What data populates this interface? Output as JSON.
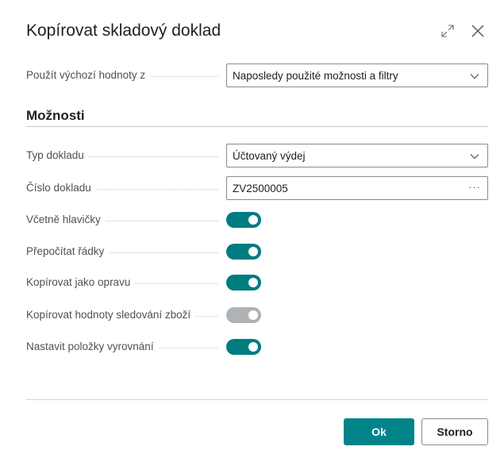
{
  "dialog": {
    "title": "Kopírovat skladový doklad",
    "expand_icon": "expand-icon",
    "close_icon": "close-icon"
  },
  "defaults": {
    "label": "Použít výchozí hodnoty z",
    "value": "Naposledy použité možnosti a filtry"
  },
  "options": {
    "section_title": "Možnosti",
    "doc_type_label": "Typ dokladu",
    "doc_type_value": "Účtovaný výdej",
    "doc_no_label": "Číslo dokladu",
    "doc_no_value": "ZV2500005",
    "doc_no_lookup": "···",
    "toggles": [
      {
        "label": "Včetně hlavičky",
        "on": true,
        "enabled": true
      },
      {
        "label": "Přepočítat řádky",
        "on": true,
        "enabled": true
      },
      {
        "label": "Kopírovat jako opravu",
        "on": true,
        "enabled": true
      },
      {
        "label": "Kopírovat hodnoty sledování zboží",
        "on": true,
        "enabled": false
      },
      {
        "label": "Nastavit položky vyrovnání",
        "on": true,
        "enabled": true
      }
    ]
  },
  "footer": {
    "ok_label": "Ok",
    "cancel_label": "Storno"
  },
  "colors": {
    "accent": "#008489",
    "toggle_on": "#007c80",
    "toggle_disabled": "#b0b3b5"
  }
}
